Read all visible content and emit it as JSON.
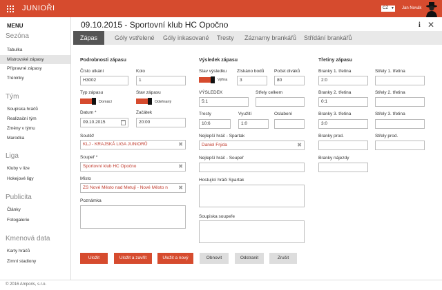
{
  "app": {
    "brand": "JUNIOŘI",
    "lang": "CZ",
    "user": "Jan Novák"
  },
  "sidebar": {
    "menu_title": "MENU",
    "sections": [
      {
        "title": "Sezóna",
        "items": [
          "Tabulka",
          "Mistrovské zápasy",
          "Přípravné zápasy",
          "Tréninky"
        ]
      },
      {
        "title": "Tým",
        "items": [
          "Soupiska hráčů",
          "Realizační tým",
          "Změny v týmu",
          "Marodka"
        ]
      },
      {
        "title": "Liga",
        "items": [
          "Kluby v lize",
          "Hokejové ligy"
        ]
      },
      {
        "title": "Publicita",
        "items": [
          "Články",
          "Fotogalerie"
        ]
      },
      {
        "title": "Kmenová data",
        "items": [
          "Karty hráčů",
          "Zimní stadiony"
        ]
      }
    ],
    "active_item": "Mistrovské zápasy"
  },
  "page": {
    "title": "09.10.2015 - Sportovní klub HC Opočno"
  },
  "tabs": [
    "Zápas",
    "Góly vstřelené",
    "Góly inkasované",
    "Tresty",
    "Záznamy brankářů",
    "Střídání brankářů"
  ],
  "details": {
    "header": "Podrobnosti zápasu",
    "cislo_label": "Číslo utkání",
    "cislo_value": "H3002",
    "kolo_label": "Kolo",
    "kolo_value": "1",
    "typ_label": "Typ zápasu",
    "typ_value": "Domácí",
    "stav_label": "Stav zápasu",
    "stav_value": "Odehraný",
    "datum_label": "Datum *",
    "datum_value": "09.10.2015",
    "zacatek_label": "Začátek",
    "zacatek_value": "20:00",
    "soutez_label": "Soutěž",
    "soutez_value": "KLJ - KRAJSKÁ LIGA JUNIORŮ",
    "souper_label": "Soupeř *",
    "souper_value": "Sportovní klub HC Opočno",
    "misto_label": "Místo",
    "misto_value": "ZS Nové Město nad Metují - Nové Město n",
    "poznamka_label": "Poznámka"
  },
  "result": {
    "header": "Výsledek zápasu",
    "stav_label": "Stav výsledku",
    "stav_value": "Výhra",
    "body_label": "Získáno bodů",
    "body_value": "3",
    "divaku_label": "Počet diváků",
    "divaku_value": "80",
    "vysledek_label": "VÝSLEDEK",
    "vysledek_value": "5:1",
    "strely_label": "Střely celkem",
    "strely_value": "",
    "tresty_label": "Tresty",
    "tresty_value": "10:6",
    "vyuziti_label": "Využití",
    "vyuziti_value": "1:0",
    "oslabeni_label": "Oslabení",
    "oslabeni_value": "",
    "best_home_label": "Nejlepší hráč - Spartak",
    "best_home_value": "Daniel Frýda",
    "best_away_label": "Nejlepší hráč - Soupeř",
    "best_away_value": "",
    "guests_label": "Hostující hráči Spartak",
    "roster_label": "Soupiska soupeře"
  },
  "periods": {
    "header": "Třetiny zápasu",
    "b1_label": "Branky 1. třetina",
    "b1_value": "2:0",
    "s1_label": "Střely 1. třetina",
    "s1_value": "",
    "b2_label": "Branky 2. třetina",
    "b2_value": "0:1",
    "s2_label": "Střely 2. třetina",
    "s2_value": "",
    "b3_label": "Branky 3. třetina",
    "b3_value": "3:0",
    "s3_label": "Střely 3. třetina",
    "s3_value": "",
    "bp_label": "Branky prod.",
    "bp_value": "",
    "sp_label": "Střely prod.",
    "sp_value": "",
    "bn_label": "Branky nájezdy",
    "bn_value": ""
  },
  "buttons": {
    "save": "Uložit",
    "save_close": "Uložit a zavřít",
    "save_new": "Uložit a nový",
    "refresh": "Obnovit",
    "delete": "Odstranit",
    "cancel": "Zrušit"
  },
  "footer": "© 2016 Amporis, s.r.o.",
  "colors": {
    "accent": "#d64b2e",
    "tabbar": "#e9e9e9",
    "active_tab": "#555555"
  }
}
